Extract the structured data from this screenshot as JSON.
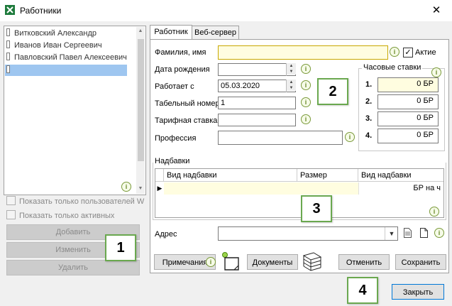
{
  "window": {
    "title": "Работники",
    "close_glyph": "✕"
  },
  "users": [
    {
      "name": "Витковский Александр",
      "selected": false
    },
    {
      "name": "Иванов Иван Сергеевич",
      "selected": false
    },
    {
      "name": "Павловский Павел Алексеевич",
      "selected": false
    },
    {
      "name": "",
      "selected": true
    }
  ],
  "filters": {
    "only_users_label": "Показать только пользователей W",
    "only_active_label": "Показать только активных"
  },
  "left_buttons": {
    "add": "Добавить",
    "edit": "Изменить",
    "delete": "Удалить"
  },
  "tabs": [
    {
      "label": "Работник",
      "active": true
    },
    {
      "label": "Веб-сервер",
      "active": false
    }
  ],
  "form": {
    "name_label": "Фамилия, имя",
    "name_value": "",
    "active_label": "Актие",
    "active_checked": true,
    "birth_label": "Дата рождения",
    "birth_value": "",
    "works_since_label": "Работает с",
    "works_since_value": "05.03.2020",
    "tab_no_label": "Табельный номер",
    "tab_no_value": "1",
    "rate_label": "Тарифная ставка",
    "rate_value": "",
    "profession_label": "Профессия",
    "profession_value": ""
  },
  "hourly_rates": {
    "title": "Часовые ставки",
    "rows": [
      {
        "n": "1.",
        "value": "0 БР"
      },
      {
        "n": "2.",
        "value": "0 БР"
      },
      {
        "n": "3.",
        "value": "0 БР"
      },
      {
        "n": "4.",
        "value": "0 БР"
      }
    ]
  },
  "allowances": {
    "title": "Надбавки",
    "columns": [
      "Вид надбавки",
      "Размер",
      "Вид надбавки"
    ],
    "row": {
      "marker": "▶",
      "type": "",
      "size": "",
      "kind": "БР на ч"
    }
  },
  "address": {
    "label": "Адрес",
    "value": ""
  },
  "bottom_buttons": {
    "notes": "Примечания",
    "documents": "Документы",
    "cancel": "Отменить",
    "save": "Сохранить",
    "close": "Закрыть"
  },
  "callouts": [
    "1",
    "2",
    "3",
    "4"
  ],
  "info_glyph": "i",
  "check_glyph": "✓",
  "colors": {
    "selection": "#9ec6f0",
    "callout_border": "#6aa84f",
    "highlight_field": "#fffde0",
    "primary_border": "#0078d7"
  }
}
